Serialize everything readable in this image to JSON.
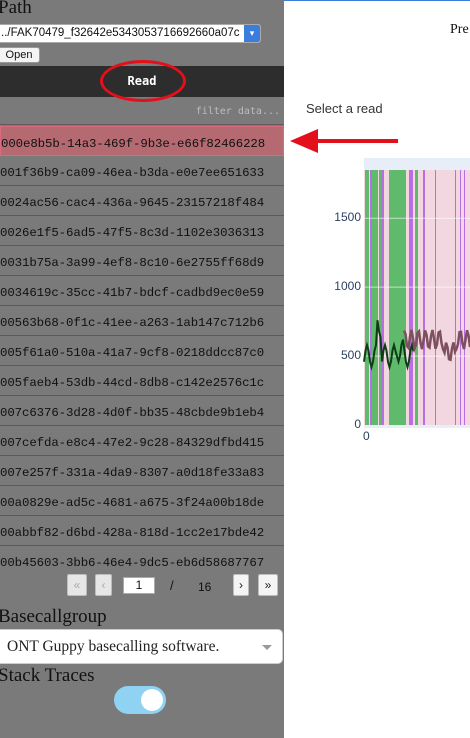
{
  "sidebar": {
    "path_label": "Path",
    "path_value": "../FAK70479_f32642e5343053716692660a07c",
    "open_button": "Open",
    "read_header": "Read",
    "filter_placeholder": "filter data...",
    "reads": [
      "000e8b5b-14a3-469f-9b3e-e66f82466228",
      "001f36b9-ca09-46ea-b3da-e0e7ee651633",
      "0024ac56-cac4-436a-9645-23157218f484",
      "0026e1f5-6ad5-47f5-8c3d-1102e3036313",
      "0031b75a-3a99-4ef8-8c10-6e2755ff68d9",
      "0034619c-35cc-41b7-bdcf-cadbd9ec0e59",
      "00563b68-0f1c-41ee-a263-1ab147c712b6",
      "005f61a0-510a-41a7-9cf8-0218ddcc87c0",
      "005faeb4-53db-44cd-8db8-c142e2576c1c",
      "007c6376-3d28-4d0f-bb35-48cbde9b1eb4",
      "007cefda-e8c4-47e2-9c28-84329dfbd415",
      "007e257f-331a-4da9-8307-a0d18fe33a83",
      "00a0829e-ad5c-4681-a675-3f24a00b18de",
      "00abbf82-d6bd-428a-818d-1cc2e17bde42",
      "00b45603-3bb6-46e4-9dc5-eb6d58687767"
    ],
    "selected_index": 0,
    "pager": {
      "first": "«",
      "prev": "‹",
      "current_page": "1",
      "slash": "/",
      "total_pages": "16",
      "next": "›",
      "last": "»"
    },
    "basecallgroup_label": "Basecallgroup",
    "basecallgroup_value": "ONT Guppy basecalling software.",
    "stack_traces_label": "Stack Traces",
    "stack_traces_on": true
  },
  "main": {
    "title": "Pre",
    "select_read_text": "Select a read"
  },
  "annotations": {
    "read_circle_color": "#e3101b",
    "arrow_color": "#e3101b"
  },
  "chart_data": {
    "type": "line",
    "y_ticks": [
      "0",
      "500",
      "1000",
      "1500"
    ],
    "x_ticks": [
      "0"
    ],
    "ylim": [
      0,
      1850
    ],
    "signal_level": 500,
    "colors": {
      "green_band": "#5fba6c",
      "purple_band": "#b76fe3",
      "pink_band": "#f3d7e0",
      "signal_dark": "#0d3d14",
      "signal_pink": "#7d5060",
      "plot_bg": "#e8eef8"
    }
  }
}
